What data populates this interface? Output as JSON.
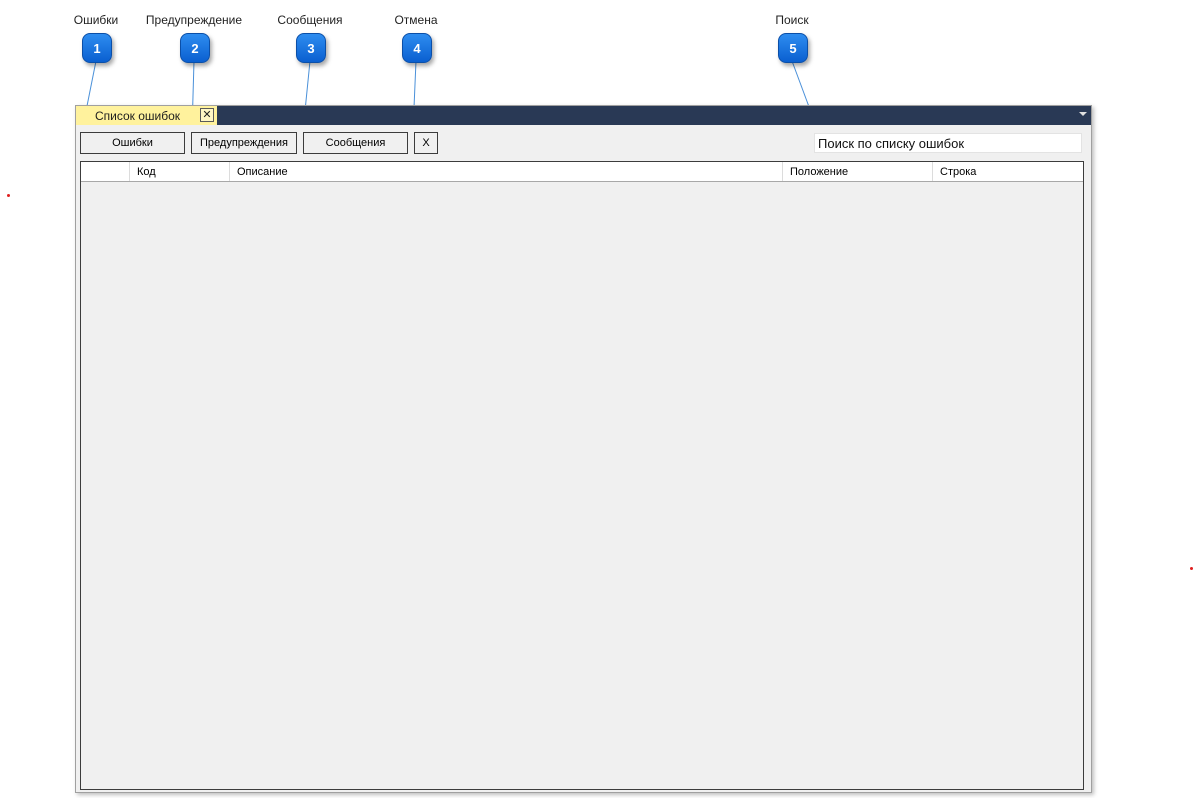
{
  "callouts": [
    {
      "number": "1",
      "label": "Ошибки"
    },
    {
      "number": "2",
      "label": "Предупреждение"
    },
    {
      "number": "3",
      "label": "Сообщения"
    },
    {
      "number": "4",
      "label": "Отмена"
    },
    {
      "number": "5",
      "label": "Поиск"
    }
  ],
  "window": {
    "tab_title": "Список ошибок",
    "tab_close_icon": "close-icon",
    "toolbar": {
      "errors_label": "Ошибки",
      "warnings_label": "Предупреждения",
      "messages_label": "Сообщения",
      "cancel_label": "X"
    },
    "search": {
      "value": "Поиск по списку ошибок"
    },
    "grid": {
      "columns": [
        "",
        "Код",
        "Описание",
        "Положение",
        "Строка"
      ]
    }
  },
  "colors": {
    "tabbar": "#293955",
    "active_tab": "#fff29d",
    "badge": "#1a73e8"
  }
}
